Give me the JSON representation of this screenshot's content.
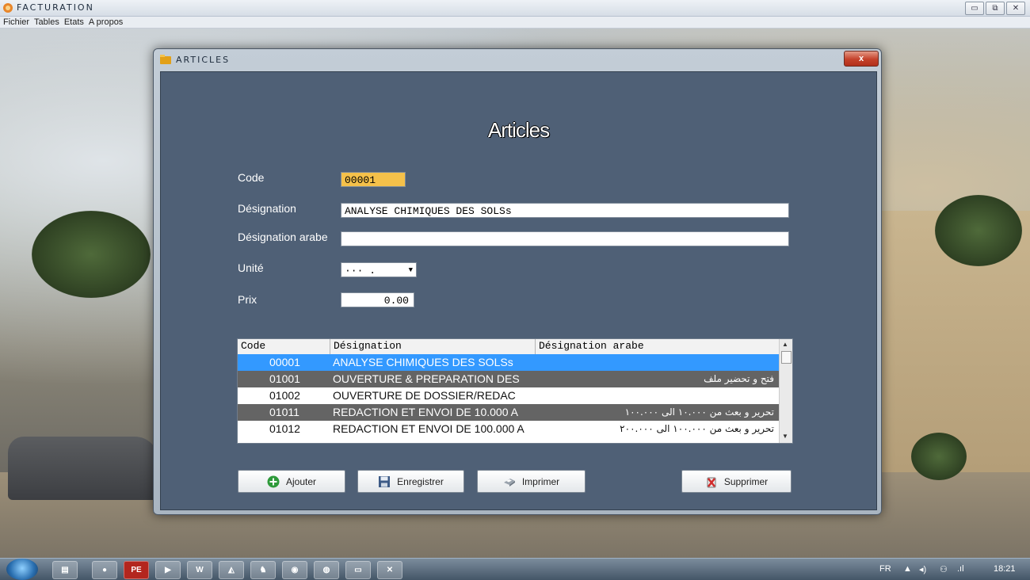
{
  "app": {
    "title": "FACTURATION",
    "window_buttons": [
      "▭",
      "⧉",
      "✕"
    ]
  },
  "menu": [
    "Fichier",
    "Tables",
    "Etats",
    "A propos"
  ],
  "dialog": {
    "title": "ARTICLES",
    "close_label": "x",
    "heading": "Articles",
    "form": {
      "code_label": "Code",
      "code_value": "00001",
      "designation_label": "Désignation",
      "designation_value": "ANALYSE CHIMIQUES DES SOLSs",
      "designation_arabe_label": "Désignation arabe",
      "designation_arabe_value": "",
      "unite_label": "Unité",
      "unite_value": "···   .",
      "prix_label": "Prix",
      "prix_value": "0.00"
    },
    "list": {
      "columns": [
        "Code",
        "Désignation",
        "Désignation arabe"
      ],
      "rows": [
        {
          "code": "00001",
          "designation": "ANALYSE CHIMIQUES DES SOLSs",
          "arabe": ""
        },
        {
          "code": "01001",
          "designation": "OUVERTURE & PREPARATION DES",
          "arabe": "فتح و تحضير ملف"
        },
        {
          "code": "01002",
          "designation": "OUVERTURE DE DOSSIER/REDAC",
          "arabe": ""
        },
        {
          "code": "01011",
          "designation": "REDACTION ET ENVOI DE 10.000 A",
          "arabe": "تحرير و بعث من ١٠.٠٠٠ الى ١٠٠.٠٠٠"
        },
        {
          "code": "01012",
          "designation": "REDACTION ET ENVOI DE 100.000 A",
          "arabe": "تحرير و بعث من ١٠٠.٠٠٠ الى ٢٠٠.٠٠٠"
        }
      ],
      "selected_index": 0
    },
    "buttons": {
      "ajouter": "Ajouter",
      "enregistrer": "Enregistrer",
      "imprimer": "Imprimer",
      "supprimer": "Supprimer"
    }
  },
  "taskbar": {
    "items": [
      "explorer-icon",
      "firefox-icon",
      "PE",
      "media-icon",
      "word-icon",
      "pdf-icon",
      "app-icon",
      "paint-icon",
      "chrome-icon",
      "window-icon",
      "tool-icon"
    ],
    "lang": "FR",
    "clock": "18:21"
  },
  "colors": {
    "panel_bg": "#4f6076",
    "code_field": "#f5c14a",
    "selection": "#3399ff",
    "alt_row": "#646464"
  }
}
